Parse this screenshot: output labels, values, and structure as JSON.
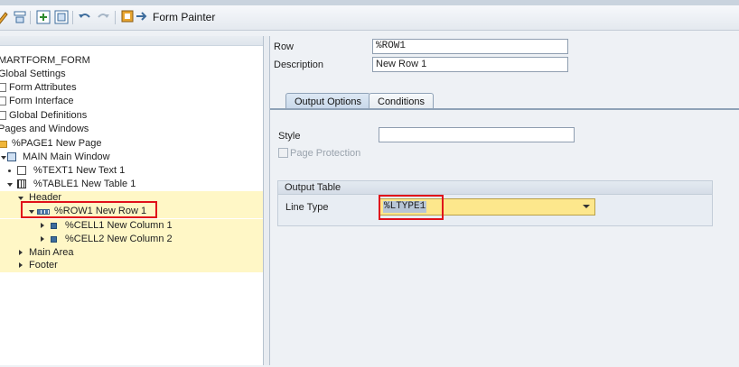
{
  "toolbar": {
    "form_painter_label": "Form Painter",
    "icons": [
      "edit-icon",
      "object-icon",
      "insert-icon",
      "delete-icon",
      "undo-icon",
      "redo-icon",
      "form-painter-icon"
    ]
  },
  "tree": {
    "root": "MARTFORM_FORM",
    "global_settings": "Global Settings",
    "form_attributes": "Form Attributes",
    "form_interface": "Form Interface",
    "global_definitions": "Global Definitions",
    "pages_and_windows": "Pages and Windows",
    "page1": "%PAGE1 New Page",
    "main_window": "MAIN Main Window",
    "text1": "%TEXT1 New Text 1",
    "table1": "%TABLE1 New Table 1",
    "header": "Header",
    "row1": "%ROW1 New Row 1",
    "cell1": "%CELL1 New Column 1",
    "cell2": "%CELL2 New Column 2",
    "main_area": "Main Area",
    "footer": "Footer"
  },
  "details": {
    "row_label": "Row",
    "row_value": "%ROW1",
    "description_label": "Description",
    "description_value": "New Row 1"
  },
  "tabs": [
    "Output Options",
    "Conditions"
  ],
  "output_options": {
    "style_label": "Style",
    "style_value": "",
    "page_protection_label": "Page Protection",
    "page_protection_checked": false,
    "output_table_title": "Output Table",
    "line_type_label": "Line Type",
    "line_type_value": "%LTYPE1"
  },
  "colors": {
    "highlight_row": "#fff7c6",
    "dropdown_bg": "#fde78c",
    "annotation_red": "#e0101a",
    "active_tab": "#c8d8ea"
  }
}
